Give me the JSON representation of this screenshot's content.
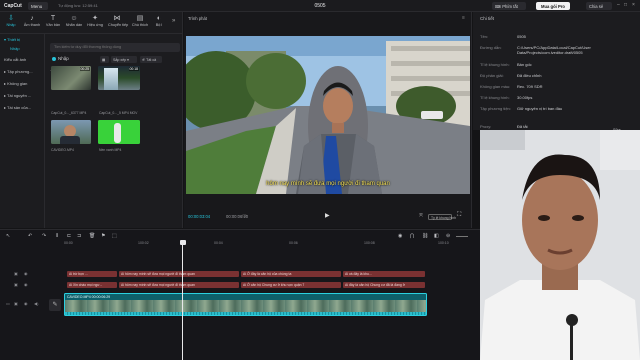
{
  "titlebar": {
    "logo": "CapCut",
    "menu_label": "Menu",
    "autosave": "Tự động lưu: 12:59:41",
    "project_title": "0505",
    "shortcut_label": "Phím tắt",
    "pro_label": "Mua gói Pro",
    "share_label": "Chia sẻ"
  },
  "tabs": [
    {
      "icon": "import-icon",
      "label": "Nhập"
    },
    {
      "icon": "audio-icon",
      "label": "Âm thanh"
    },
    {
      "icon": "text-icon",
      "label": "Văn bản"
    },
    {
      "icon": "sticker-icon",
      "label": "Nhãn dán"
    },
    {
      "icon": "effects-icon",
      "label": "Hiệu ứng"
    },
    {
      "icon": "transition-icon",
      "label": "Chuyển tiếp"
    },
    {
      "icon": "caption-icon",
      "label": "Chú thích"
    },
    {
      "icon": "filter-icon",
      "label": "Bộ l"
    }
  ],
  "side_nav": {
    "local": "▾ Thiết bị",
    "import": "Nhập",
    "style": "Kiểu cắt ảnh",
    "items": [
      "▸ Tập phương...",
      "▸ Không gian",
      "▸ Tài nguyên ...",
      "▸ Tài sản của..."
    ]
  },
  "media": {
    "search_placeholder": "Tìm kiếm tư duy đổi thương thông dùng",
    "import_label": "Nhập",
    "sort_label": "Sắp xếp",
    "filter_label": "Tất cả",
    "all_label": "Tất cả",
    "items": [
      {
        "name": "CapCut_0..._6377 MP4",
        "duration": "00:25"
      },
      {
        "name": "CapCut_0..._5 MP4 MOV",
        "duration": "00:18"
      },
      {
        "name": "CAVIDEO.MP4",
        "duration": ""
      },
      {
        "name": "Nền xanh MP4",
        "duration": ""
      }
    ]
  },
  "player": {
    "label": "Trình phát",
    "subtitle": "hôm nay mình sẽ đưa mọi người đi tham quan",
    "timecode": "00:00:03:04",
    "duration": "00:00:06:20",
    "ratio_label": "Tỷ lệ khung hình"
  },
  "details": {
    "title": "Chi tiết",
    "rows": [
      {
        "key": "Tên:",
        "value": "0505"
      },
      {
        "key": "Đường dẫn:",
        "value": "C:/Users/PC/AppData/Local/CapCut/User Data/Projects/com.lveditor.draft/0505"
      },
      {
        "key": "Tỉ lệ khung hình:",
        "value": "Bản gốc"
      },
      {
        "key": "Độ phân giải:",
        "value": "Đã điều chỉnh"
      },
      {
        "key": "Không gian màu:",
        "value": "Rec. 709 SDR"
      },
      {
        "key": "Tỉ lệ khung hình:",
        "value": "30.00fps"
      },
      {
        "key": "Tập phương tiện:",
        "value": "Giữ nguyên vị trí ban đầu"
      },
      {
        "key": "Proxy:",
        "value": "Đã tắt"
      }
    ],
    "edit_label": "Sửa"
  },
  "timeline": {
    "ticks": [
      "00:00",
      "100:02",
      "00:04",
      "00:06",
      "100:08",
      "100:10"
    ],
    "subtitle_row1": [
      {
        "text": "Ai  trừ bọn ..."
      },
      {
        "text": "Ai  hôm nay mình sẽ đưa mọi người đi tham quan"
      },
      {
        "text": "Ai  Ở đây là căn hộ của chúng ta"
      },
      {
        "text": "Ai  và đây là khu..."
      }
    ],
    "subtitle_row2": [
      {
        "text": "Ai  Xin chào mọi ngư..."
      },
      {
        "text": "Ai  hôm nay mình sẽ đưa mọi người đi tham quan"
      },
      {
        "text": "Ai  Ở căn hộ Chung cư ở khu vực quận 7"
      },
      {
        "text": "Ai  đây là căn hộ Chung cư đã là đang ở"
      }
    ],
    "main_clip_label": "CAVIDEO.MP4  00:00:06:29",
    "cover_label": "Bìa"
  }
}
